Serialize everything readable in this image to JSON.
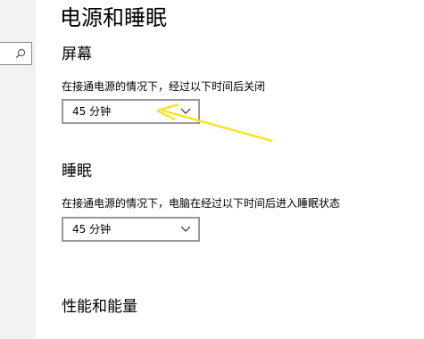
{
  "page": {
    "title": "电源和睡眠"
  },
  "search": {
    "icon": "search-icon"
  },
  "screen": {
    "title": "屏幕",
    "description": "在接通电源的情况下，经过以下时间后关闭",
    "selected": "45 分钟"
  },
  "sleep": {
    "title": "睡眠",
    "description": "在接通电源的情况下，电脑在经过以下时间后进入睡眠状态",
    "selected": "45 分钟"
  },
  "performance": {
    "title": "性能和能量"
  },
  "annotation": {
    "color": "#f5e52a"
  }
}
